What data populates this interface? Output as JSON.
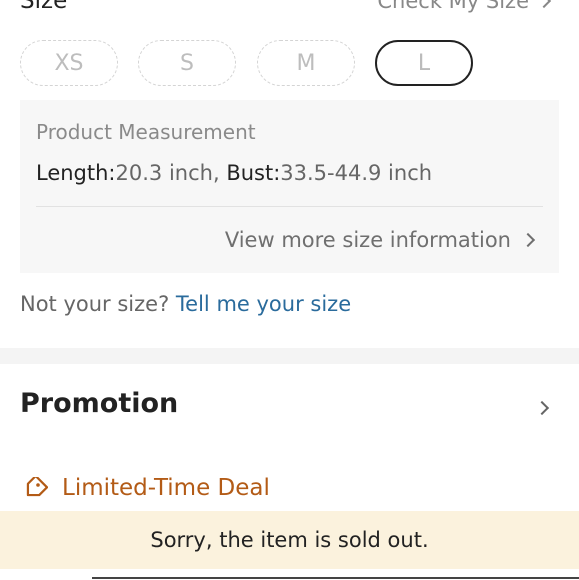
{
  "size_section": {
    "title": "Size",
    "check_my_size": "Check My Size"
  },
  "size_options": [
    "XS",
    "S",
    "M",
    "L"
  ],
  "selected_size": "L",
  "measurement": {
    "title": "Product Measurement",
    "length_label": "Length:",
    "length_value": "20.3 inch,",
    "bust_label": "Bust:",
    "bust_value": "33.5-44.9 inch",
    "view_more": "View more size information"
  },
  "size_prompt": {
    "text": "Not your size?",
    "link": "Tell me your size"
  },
  "promotion": {
    "title": "Promotion",
    "deal_label": "Limited-Time Deal"
  },
  "status": {
    "sold_out": "Sorry, the item is sold out."
  },
  "colors": {
    "deal_accent": "#b35b16",
    "link": "#2a6b9c",
    "sold_out_bg": "#fbf2dd"
  }
}
